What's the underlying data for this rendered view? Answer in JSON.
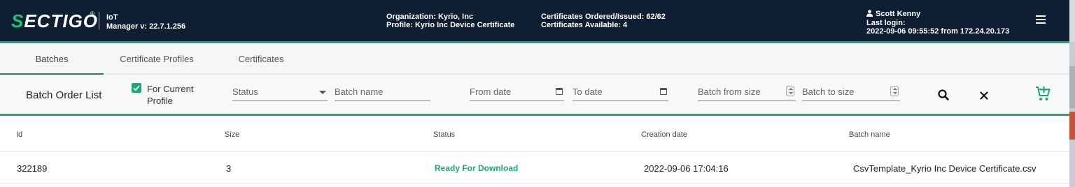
{
  "header": {
    "logo_text": "ECTIGO",
    "logo_s": "S",
    "logo_reg": "®",
    "app_name": "IoT",
    "app_version": "Manager v: 22.7.1.256",
    "organization": "Organization: Kyrio, Inc",
    "profile": "Profile: Kyrio Inc Device Certificate",
    "certs_ordered": "Certificates Ordered/Issued: 62/62",
    "certs_available": "Certificates Available: 4",
    "user_name": "Scott Kenny",
    "last_login_label": "Last login:",
    "last_login_value": "2022-09-06 09:55:52 from 172.24.20.173",
    "colors": {
      "background": "#0e1f33",
      "accent": "#19a974"
    }
  },
  "tabs": [
    {
      "label": "Batches",
      "active": true
    },
    {
      "label": "Certificate Profiles",
      "active": false
    },
    {
      "label": "Certificates",
      "active": false
    }
  ],
  "toolbar": {
    "title": "Batch Order List",
    "for_current_profile_line1": "For Current",
    "for_current_profile_line2": "Profile",
    "for_current_profile_checked": true,
    "status_placeholder": "Status",
    "batch_name_placeholder": "Batch name",
    "from_date_placeholder": "From date",
    "to_date_placeholder": "To date",
    "batch_from_size_placeholder": "Batch from size",
    "batch_to_size_placeholder": "Batch to size",
    "icons": [
      "search-icon",
      "clear-icon",
      "cart-add-icon"
    ]
  },
  "table": {
    "columns": [
      "Id",
      "Size",
      "Status",
      "Creation date",
      "Batch name"
    ],
    "rows": [
      {
        "id": "322189",
        "size": "3",
        "status": "Ready For Download",
        "creation_date": "2022-09-06 17:04:16",
        "batch_name": "CsvTemplate_Kyrio Inc Device Certificate.csv"
      }
    ]
  }
}
